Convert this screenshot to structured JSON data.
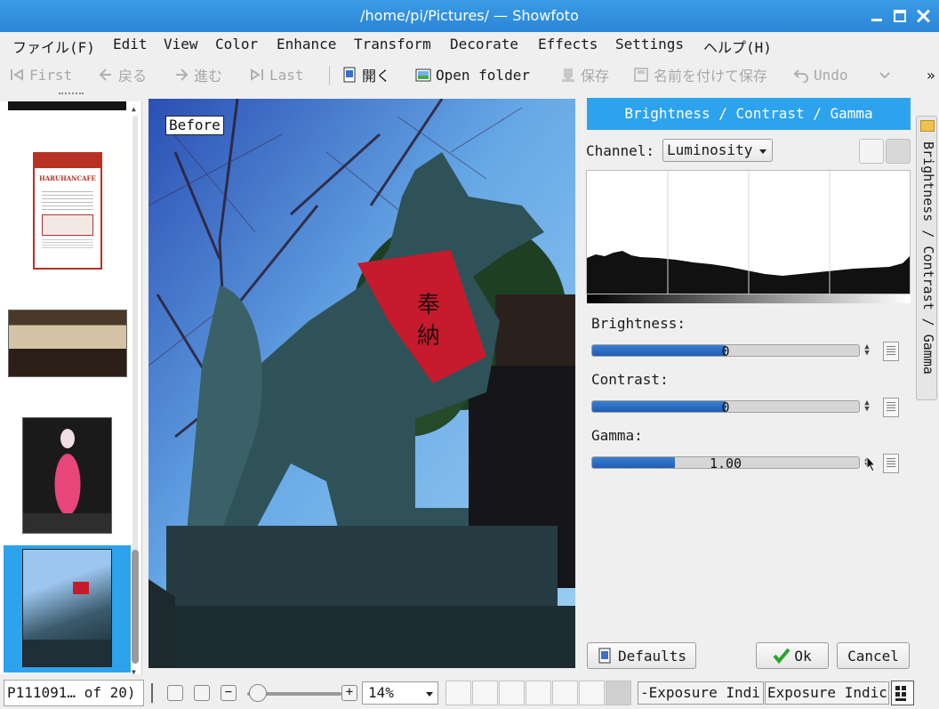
{
  "window": {
    "title": "/home/pi/Pictures/ — Showfoto"
  },
  "menubar": [
    "ファイル(F)",
    "Edit",
    "View",
    "Color",
    "Enhance",
    "Transform",
    "Decorate",
    "Effects",
    "Settings",
    "ヘルプ(H)"
  ],
  "toolbar": {
    "first": "First",
    "back": "戻る",
    "forward": "進む",
    "last": "Last",
    "open": "開く",
    "open_folder": "Open folder",
    "save": "保存",
    "save_as": "名前を付けて保存",
    "undo": "Undo",
    "more": "»"
  },
  "canvas": {
    "before_label": "Before"
  },
  "thumbnails": [
    {
      "name": "haruhancafe-flyer",
      "text": "HARUHANCAFE",
      "selected": false
    },
    {
      "name": "group-photo",
      "selected": false
    },
    {
      "name": "kimono-doll",
      "selected": false
    },
    {
      "name": "fox-statue",
      "selected": true
    }
  ],
  "tool": {
    "title": "Brightness / Contrast / Gamma",
    "channel_label": "Channel:",
    "channel_value": "Luminosity",
    "brightness_label": "Brightness:",
    "brightness_value": "0",
    "brightness_fill": 0.5,
    "contrast_label": "Contrast:",
    "contrast_value": "0",
    "contrast_fill": 0.5,
    "gamma_label": "Gamma:",
    "gamma_value": "1.00",
    "gamma_fill": 0.31,
    "defaults_label": "Defaults",
    "ok_label": "Ok",
    "cancel_label": "Cancel"
  },
  "sidetab": {
    "label": "Brightness / Contrast / Gamma"
  },
  "statusbar": {
    "filename": "P111091… of 20)",
    "zoom": "14%",
    "zoom_fill": 0.02,
    "exposure_1": "-Exposure Indi",
    "exposure_2": "Exposure Indic"
  },
  "colors": {
    "accent": "#2da3ee",
    "titlebar": "#3a9be6",
    "slider_fill": "#1f5db4",
    "ok_check": "#2aa52a"
  }
}
